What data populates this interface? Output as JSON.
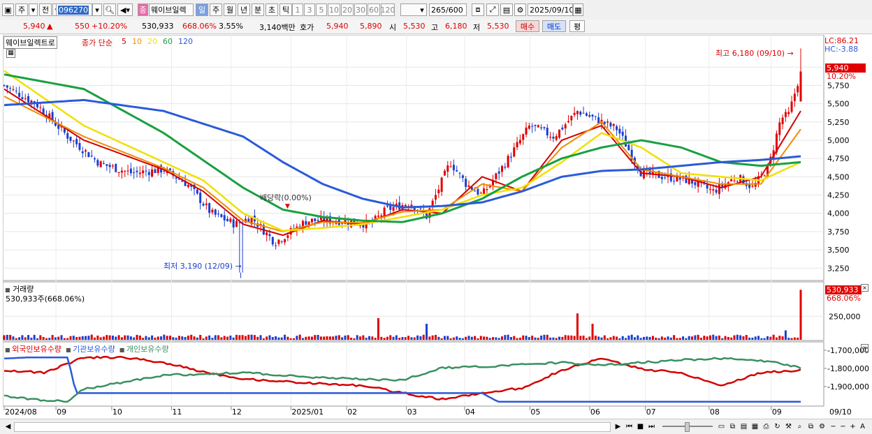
{
  "toolbar": {
    "period_primary": "주",
    "period_compare": "전",
    "stock_code": "096270",
    "badge": "종",
    "stock_name": "웨이브일렉",
    "period_tabs": [
      "일",
      "주",
      "월",
      "년",
      "분",
      "초",
      "틱"
    ],
    "active_period": "일",
    "minute_options": [
      "1",
      "3",
      "5",
      "10",
      "20",
      "30",
      "60",
      "120"
    ],
    "data_count": "265",
    "data_total": "/600",
    "date": "2025/09/10"
  },
  "quote": {
    "price": "5,940",
    "change": "550",
    "change_pct": "+10.20%",
    "volume": "530,933",
    "volume_ratio": "668.06%",
    "turnover_pct": "3.55%",
    "amount": "3,140백만",
    "ask_label": "호가",
    "ask": "5,940",
    "bid": "5,890",
    "open_label": "시",
    "open": "5,530",
    "high_label": "고",
    "high": "6,180",
    "low_label": "저",
    "low": "5,530",
    "buy_label": "매수",
    "sell_label": "매도",
    "eval_label": "평"
  },
  "price_panel": {
    "name": "웨이브일렉트로",
    "ma_label": "종가 단순",
    "ma_periods": [
      "5",
      "10",
      "20",
      "60",
      "120"
    ],
    "lc": "LC:86.21",
    "hc": "HC:-3.88",
    "high_marker": "최고 6,180 (09/10)",
    "low_marker": "최저 3,190 (12/09)",
    "dividend": "배당락(0.00%)",
    "current_price_tag": "5,940",
    "current_pct_tag": "10.20%",
    "y_ticks": [
      "6,000",
      "5,750",
      "5,500",
      "5,250",
      "5,000",
      "4,750",
      "4,500",
      "4,250",
      "4,000",
      "3,750",
      "3,500",
      "3,250"
    ]
  },
  "volume_panel": {
    "title": "거래량",
    "value_text": "530,933주(668.06%)",
    "tag_value": "530,933",
    "tag_pct": "668.06%",
    "y_tick": "250,000"
  },
  "holdings_panel": {
    "legend": [
      "외국인보유수량",
      "기관보유수량",
      "개인보유수량"
    ],
    "y_ticks": [
      "-1,700,000",
      "-1,800,000",
      "-1,900,000"
    ]
  },
  "x_axis": [
    "2024/08",
    "09",
    "10",
    "11",
    "12",
    "2025/01",
    "02",
    "03",
    "04",
    "05",
    "06",
    "07",
    "08",
    "09",
    "09/10"
  ],
  "colors": {
    "up": "#e00000",
    "down": "#1a3fd0",
    "ma5": "#d40000",
    "ma10": "#f08c00",
    "ma20": "#f0e000",
    "ma60": "#18a040",
    "ma120": "#2a5ad8",
    "foreign": "#d40000",
    "institution": "#2a5ad8",
    "individual": "#3a9060"
  },
  "chart_data": {
    "type": "candlestick",
    "title": "웨이브일렉트로",
    "ylim": [
      3100,
      6250
    ],
    "high": 6180,
    "low": 3190,
    "last_close": 5940,
    "close_path": {
      "t": [
        0.0,
        0.04,
        0.08,
        0.12,
        0.16,
        0.2,
        0.23,
        0.26,
        0.29,
        0.31,
        0.34,
        0.36,
        0.38,
        0.42,
        0.46,
        0.48,
        0.51,
        0.53,
        0.56,
        0.58,
        0.6,
        0.63,
        0.66,
        0.69,
        0.72,
        0.75,
        0.77,
        0.8,
        0.83,
        0.86,
        0.89,
        0.92,
        0.94,
        0.96,
        0.975,
        0.985,
        1.0
      ],
      "price": [
        5750,
        5500,
        5050,
        4680,
        4550,
        4600,
        4400,
        4000,
        3850,
        3950,
        3600,
        3750,
        3900,
        3900,
        3850,
        4050,
        4150,
        3950,
        4700,
        4400,
        4250,
        4700,
        5200,
        5050,
        5400,
        5250,
        5150,
        4550,
        4500,
        4450,
        4300,
        4500,
        4350,
        4650,
        5300,
        5350,
        5940
      ]
    },
    "ma": {
      "5": {
        "t": [
          0,
          0.1,
          0.2,
          0.25,
          0.3,
          0.35,
          0.4,
          0.45,
          0.5,
          0.55,
          0.6,
          0.65,
          0.7,
          0.75,
          0.8,
          0.85,
          0.9,
          0.95,
          1.0
        ],
        "price": [
          5700,
          5000,
          4600,
          4300,
          3850,
          3700,
          3900,
          3850,
          4050,
          4000,
          4500,
          4300,
          5000,
          5200,
          4550,
          4500,
          4350,
          4500,
          5400
        ]
      },
      "10": {
        "t": [
          0,
          0.1,
          0.2,
          0.25,
          0.3,
          0.35,
          0.4,
          0.45,
          0.5,
          0.55,
          0.6,
          0.65,
          0.7,
          0.75,
          0.8,
          0.85,
          0.9,
          0.95,
          1.0
        ],
        "price": [
          5600,
          5050,
          4620,
          4350,
          3900,
          3750,
          3880,
          3870,
          4020,
          4050,
          4400,
          4300,
          4900,
          5250,
          4600,
          4500,
          4400,
          4400,
          5150
        ]
      },
      "20": {
        "t": [
          0,
          0.1,
          0.2,
          0.25,
          0.3,
          0.35,
          0.4,
          0.45,
          0.5,
          0.55,
          0.6,
          0.65,
          0.7,
          0.75,
          0.8,
          0.85,
          0.9,
          0.95,
          1.0
        ],
        "price": [
          5950,
          5200,
          4700,
          4450,
          4000,
          3760,
          3800,
          3850,
          3950,
          4050,
          4250,
          4350,
          4700,
          5100,
          4900,
          4550,
          4500,
          4450,
          4700
        ]
      },
      "60": {
        "t": [
          0,
          0.1,
          0.2,
          0.3,
          0.35,
          0.4,
          0.45,
          0.5,
          0.55,
          0.6,
          0.65,
          0.7,
          0.75,
          0.8,
          0.85,
          0.9,
          0.95,
          1.0
        ],
        "price": [
          5900,
          5700,
          5100,
          4350,
          4050,
          3950,
          3900,
          3880,
          4000,
          4200,
          4500,
          4750,
          4900,
          5000,
          4900,
          4700,
          4650,
          4700
        ]
      },
      "120": {
        "t": [
          0,
          0.1,
          0.2,
          0.3,
          0.35,
          0.4,
          0.45,
          0.5,
          0.55,
          0.6,
          0.65,
          0.7,
          0.75,
          0.8,
          0.85,
          0.9,
          0.95,
          1.0
        ],
        "price": [
          5480,
          5550,
          5400,
          5050,
          4700,
          4400,
          4200,
          4080,
          4100,
          4150,
          4300,
          4500,
          4580,
          4600,
          4650,
          4700,
          4730,
          4780
        ]
      }
    },
    "volume": {
      "ylim": [
        0,
        600000
      ],
      "last": 530933,
      "spikes": [
        {
          "t": 0.47,
          "v": 230000
        },
        {
          "t": 0.53,
          "v": 170000
        },
        {
          "t": 0.72,
          "v": 280000
        },
        {
          "t": 0.74,
          "v": 170000
        },
        {
          "t": 0.98,
          "v": 100000
        },
        {
          "t": 1.0,
          "v": 530933
        }
      ]
    },
    "holdings": {
      "foreign": {
        "t": [
          0,
          0.05,
          0.1,
          0.15,
          0.2,
          0.25,
          0.3,
          0.4,
          0.45,
          0.5,
          0.55,
          0.6,
          0.65,
          0.7,
          0.75,
          0.8,
          0.85,
          0.9,
          0.95,
          1.0
        ],
        "y": [
          0.35,
          0.4,
          0.1,
          0.1,
          0.2,
          0.38,
          0.52,
          0.62,
          0.65,
          0.8,
          0.92,
          0.8,
          0.7,
          0.35,
          0.12,
          0.33,
          0.4,
          0.65,
          0.4,
          0.35
        ]
      },
      "institution": {
        "t": [
          0,
          0.03,
          0.08,
          0.09,
          0.25,
          0.45,
          0.5,
          0.6,
          0.62,
          1.0
        ],
        "y": [
          0.12,
          0.1,
          0.1,
          0.8,
          0.8,
          0.8,
          0.8,
          0.8,
          0.97,
          0.97
        ]
      },
      "individual": {
        "t": [
          0,
          0.05,
          0.08,
          0.1,
          0.2,
          0.3,
          0.4,
          0.5,
          0.55,
          0.6,
          0.7,
          0.75,
          0.8,
          0.85,
          0.9,
          0.93,
          0.96,
          1.0
        ],
        "y": [
          0.85,
          0.95,
          0.95,
          0.72,
          0.45,
          0.4,
          0.5,
          0.55,
          0.3,
          0.28,
          0.2,
          0.25,
          0.2,
          0.15,
          0.12,
          0.15,
          0.18,
          0.3
        ]
      }
    }
  }
}
